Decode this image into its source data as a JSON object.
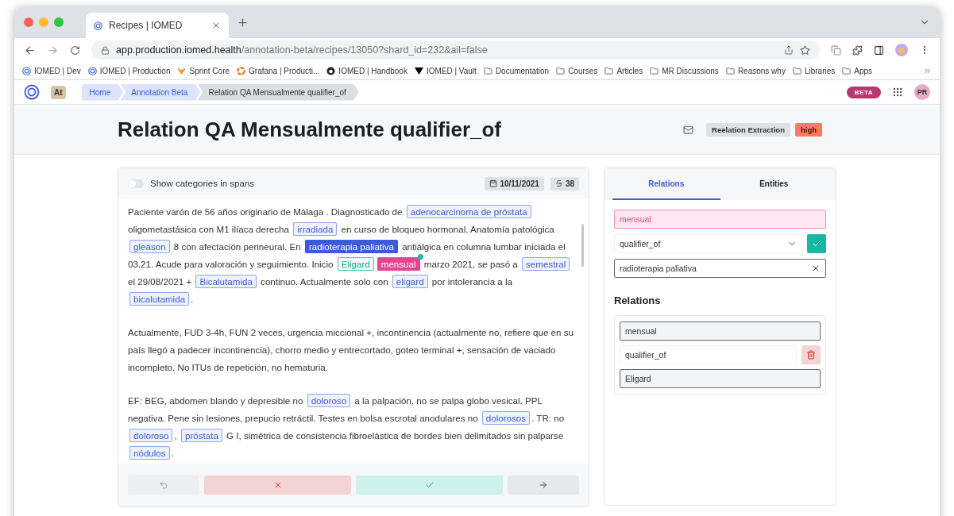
{
  "browser": {
    "tab": {
      "title": "Recipes | IOMED"
    },
    "url": {
      "host": "app.production.iomed.health",
      "path": "/annotation-beta/recipes/13050?shard_id=232&ail=false"
    },
    "bookmarks": [
      {
        "label": "IOMED | Dev",
        "kind": "iomed"
      },
      {
        "label": "IOMED | Production",
        "kind": "iomed"
      },
      {
        "label": "Sprint Core",
        "kind": "fox"
      },
      {
        "label": "Grafana | Producti...",
        "kind": "swirl"
      },
      {
        "label": "IOMED | Handbook",
        "kind": "cat"
      },
      {
        "label": "IOMED | Vault",
        "kind": "triangle"
      },
      {
        "label": "Documentation",
        "kind": "folder"
      },
      {
        "label": "Courses",
        "kind": "folder"
      },
      {
        "label": "Articles",
        "kind": "folder"
      },
      {
        "label": "MR Discussions",
        "kind": "folder"
      },
      {
        "label": "Reasons why",
        "kind": "folder"
      },
      {
        "label": "Libraries",
        "kind": "folder"
      },
      {
        "label": "Apps",
        "kind": "folder"
      }
    ]
  },
  "navbar": {
    "workspace_badge": "At",
    "breadcrumbs": [
      {
        "label": "Home",
        "selected": false
      },
      {
        "label": "Annotation Beta",
        "selected": false
      },
      {
        "label": "Relation QA Mensualmente qualifier_of",
        "selected": true
      }
    ],
    "beta_badge": "BETA",
    "avatar": "PR"
  },
  "header": {
    "title": "Relation QA Mensualmente qualifier_of",
    "tags": [
      {
        "label": "Reelation Extraction",
        "kind": "type"
      },
      {
        "label": "high",
        "kind": "priority"
      }
    ]
  },
  "document": {
    "toggle": {
      "label": "Show categories in spans",
      "on": false
    },
    "date": "10/11/2021",
    "count": "38",
    "paragraphs": [
      [
        {
          "text": "Paciente varón de 56 años originario de Málaga . Diagnosticado de ",
          "kind": "plain"
        },
        {
          "text": "adenocarcinoma de próstata",
          "kind": "entity"
        },
        {
          "text": " oligometastásica con M1 ilíaca derecha ",
          "kind": "plain"
        },
        {
          "text": "irradiada",
          "kind": "entity"
        },
        {
          "text": " en curso de bloqueo hormonal. Anatomía patológica ",
          "kind": "plain"
        },
        {
          "text": "gleason",
          "kind": "entity"
        },
        {
          "text": " 8 con afectación perineural. En ",
          "kind": "plain"
        },
        {
          "text": "radioterapia paliativa",
          "kind": "target"
        },
        {
          "text": " antiálgica en columna lumbar iniciada el 03.21. Acude para valoración y seguimiento. Inicio ",
          "kind": "plain"
        },
        {
          "text": "Eligard",
          "kind": "related"
        },
        {
          "text": "mensual",
          "kind": "source"
        },
        {
          "text": " marzo 2021, se pasó a ",
          "kind": "plain"
        },
        {
          "text": "semestral",
          "kind": "entity"
        },
        {
          "text": " el 29/08/2021 + ",
          "kind": "plain"
        },
        {
          "text": "Bicalutamida",
          "kind": "entity"
        },
        {
          "text": " continuo. Actualmente solo con ",
          "kind": "plain"
        },
        {
          "text": "eligard",
          "kind": "entity"
        },
        {
          "text": " por intolerancia a la ",
          "kind": "plain"
        },
        {
          "text": "bicalutamida",
          "kind": "entity"
        },
        {
          "text": ".",
          "kind": "plain"
        }
      ],
      [
        {
          "text": "Actualmente, FUD 3-4h, FUN 2 veces, urgencia miccional +, incontinencia (actualmente no, refiere que en su país llegó a padecer incontinencia), chorro medio y entrecortado, goteo terminal +, sensación de vaciado incompleto. No ITUs de repetición, no hematuria.",
          "kind": "plain"
        }
      ],
      [
        {
          "text": "EF: BEG, abdomen blando y depresible no ",
          "kind": "plain"
        },
        {
          "text": "doloroso",
          "kind": "entity"
        },
        {
          "text": " a la palpación, no se palpa globo vesical. PPL negativa. Pene sin lesiones, prepucio retráctil. Testes en bolsa escrotal anodulares no ",
          "kind": "plain"
        },
        {
          "text": "dolorosos",
          "kind": "entity"
        },
        {
          "text": ". TR: no ",
          "kind": "plain"
        },
        {
          "text": "doloroso",
          "kind": "entity"
        },
        {
          "text": ", ",
          "kind": "plain"
        },
        {
          "text": "próstata",
          "kind": "entity"
        },
        {
          "text": " G I, simétrica de consistencia fibroelástica de bordes bien delimitados sin palparse ",
          "kind": "plain"
        },
        {
          "text": "nódulos",
          "kind": "entity"
        },
        {
          "text": ".",
          "kind": "plain"
        }
      ]
    ],
    "actions": [
      {
        "kind": "undo"
      },
      {
        "kind": "reject"
      },
      {
        "kind": "accept"
      },
      {
        "kind": "next"
      }
    ]
  },
  "panel": {
    "tabs": [
      {
        "label": "Relations",
        "selected": true
      },
      {
        "label": "Entities",
        "selected": false
      }
    ],
    "form": {
      "source": "mensual",
      "relation": "qualifier_of",
      "target": "radioterapia paliativa"
    },
    "section_title": "Relations",
    "relations": [
      {
        "source": "mensual",
        "relation": "qualifier_of",
        "target": "Eligard"
      }
    ]
  }
}
